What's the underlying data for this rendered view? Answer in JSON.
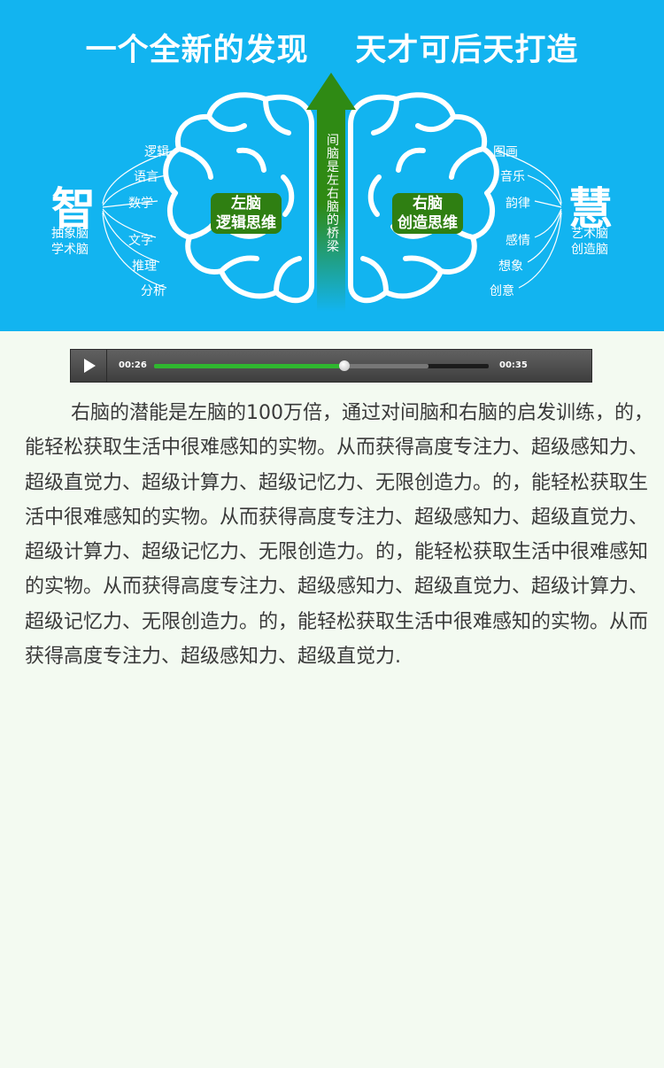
{
  "banner": {
    "title": "一个全新的发现    天才可后天打造",
    "left_big": "智",
    "left_sub": [
      "抽象脑",
      "学术脑"
    ],
    "right_big": "慧",
    "right_sub": [
      "艺术脑",
      "创造脑"
    ],
    "left_skills": [
      "逻辑",
      "语言",
      "数学",
      "文字",
      "推理",
      "分析"
    ],
    "right_skills": [
      "图画",
      "音乐",
      "韵律",
      "感情",
      "想象",
      "创意"
    ],
    "left_brain_label": [
      "左脑",
      "逻辑思维"
    ],
    "right_brain_label": [
      "右脑",
      "创造思维"
    ],
    "arrow_text": "间脑是左右脑的桥梁",
    "colors": {
      "background": "#12b4f0",
      "arrow": "#2f7f12",
      "label_bg": "#2f7f12"
    }
  },
  "player": {
    "current_time": "00:26",
    "total_time": "00:35",
    "progress": 0.57,
    "buffered": 0.82,
    "play_icon": "play-icon"
  },
  "article": {
    "text": "右脑的潜能是左脑的100万倍，通过对间脑和右脑的启发训练，的，能轻松获取生活中很难感知的实物。从而获得高度专注力、超级感知力、超级直觉力、超级计算力、超级记忆力、无限创造力。的，能轻松获取生活中很难感知的实物。从而获得高度专注力、超级感知力、超级直觉力、超级计算力、超级记忆力、无限创造力。的，能轻松获取生活中很难感知的实物。从而获得高度专注力、超级感知力、超级直觉力、超级计算力、超级记忆力、无限创造力。的，能轻松获取生活中很难感知的实物。从而获得高度专注力、超级感知力、超级直觉力."
  }
}
